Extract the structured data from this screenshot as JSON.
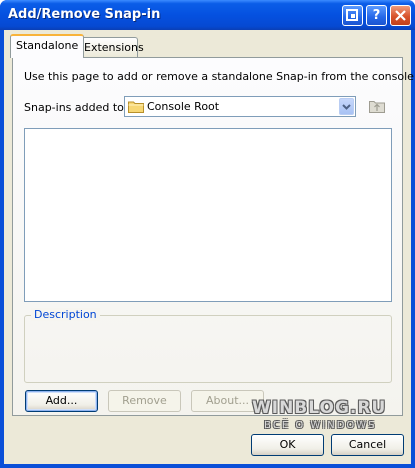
{
  "window": {
    "title": "Add/Remove Snap-in"
  },
  "tabs": [
    {
      "label": "Standalone",
      "active": true
    },
    {
      "label": "Extensions",
      "active": false
    }
  ],
  "standalone": {
    "instructions": "Use this page to add or remove a standalone Snap-in from the console.",
    "snapins_added_to_label": "Snap-ins added to:",
    "snapins_added_to_value": "Console Root",
    "snapins_list": [],
    "description_label": "Description"
  },
  "buttons": {
    "add": "Add...",
    "remove": "Remove",
    "about": "About...",
    "ok": "OK",
    "cancel": "Cancel"
  },
  "watermark": {
    "main": "WINBLOG.RU",
    "sub": "ВСЁ О WINDOWS"
  },
  "colors": {
    "titlebar": "#0551e0",
    "dialog_face": "#ece9d8",
    "group_title": "#0046d5",
    "button_border": "#003c74"
  }
}
